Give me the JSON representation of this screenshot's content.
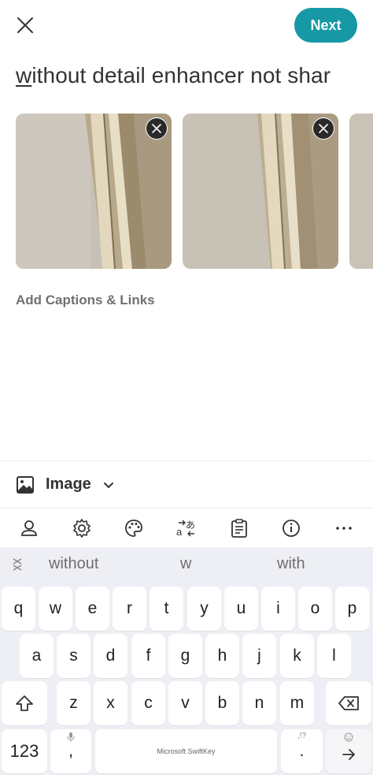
{
  "header": {
    "close_icon": "close-icon",
    "next_label": "Next",
    "title_first": "w",
    "title_rest": "ithout detail enhancer not shar"
  },
  "images": [
    {
      "remove_icon": "close-icon"
    },
    {
      "remove_icon": "close-icon"
    },
    {
      "remove_icon": "close-icon"
    }
  ],
  "captions_label": "Add Captions & Links",
  "media": {
    "icon": "image-icon",
    "label": "Image",
    "chevron": "chevron-down-icon"
  },
  "toolbar": [
    "avatar-icon",
    "gear-icon",
    "palette-icon",
    "translate-icon",
    "clipboard-icon",
    "info-icon",
    "more-icon"
  ],
  "suggestions": [
    "without",
    "w",
    "with"
  ],
  "keyboard": {
    "row1": [
      "q",
      "w",
      "e",
      "r",
      "t",
      "y",
      "u",
      "i",
      "o",
      "p"
    ],
    "row2": [
      "a",
      "s",
      "d",
      "f",
      "g",
      "h",
      "j",
      "k",
      "l"
    ],
    "row3": [
      "z",
      "x",
      "c",
      "v",
      "b",
      "n",
      "m"
    ],
    "numbers_label": "123",
    "comma_label": ",",
    "space_label": "Microsoft SwiftKey",
    "period_label": ".",
    "period_hint": ",!?"
  },
  "colors": {
    "accent": "#1698a5",
    "keyboard_bg": "#eeeff4"
  }
}
